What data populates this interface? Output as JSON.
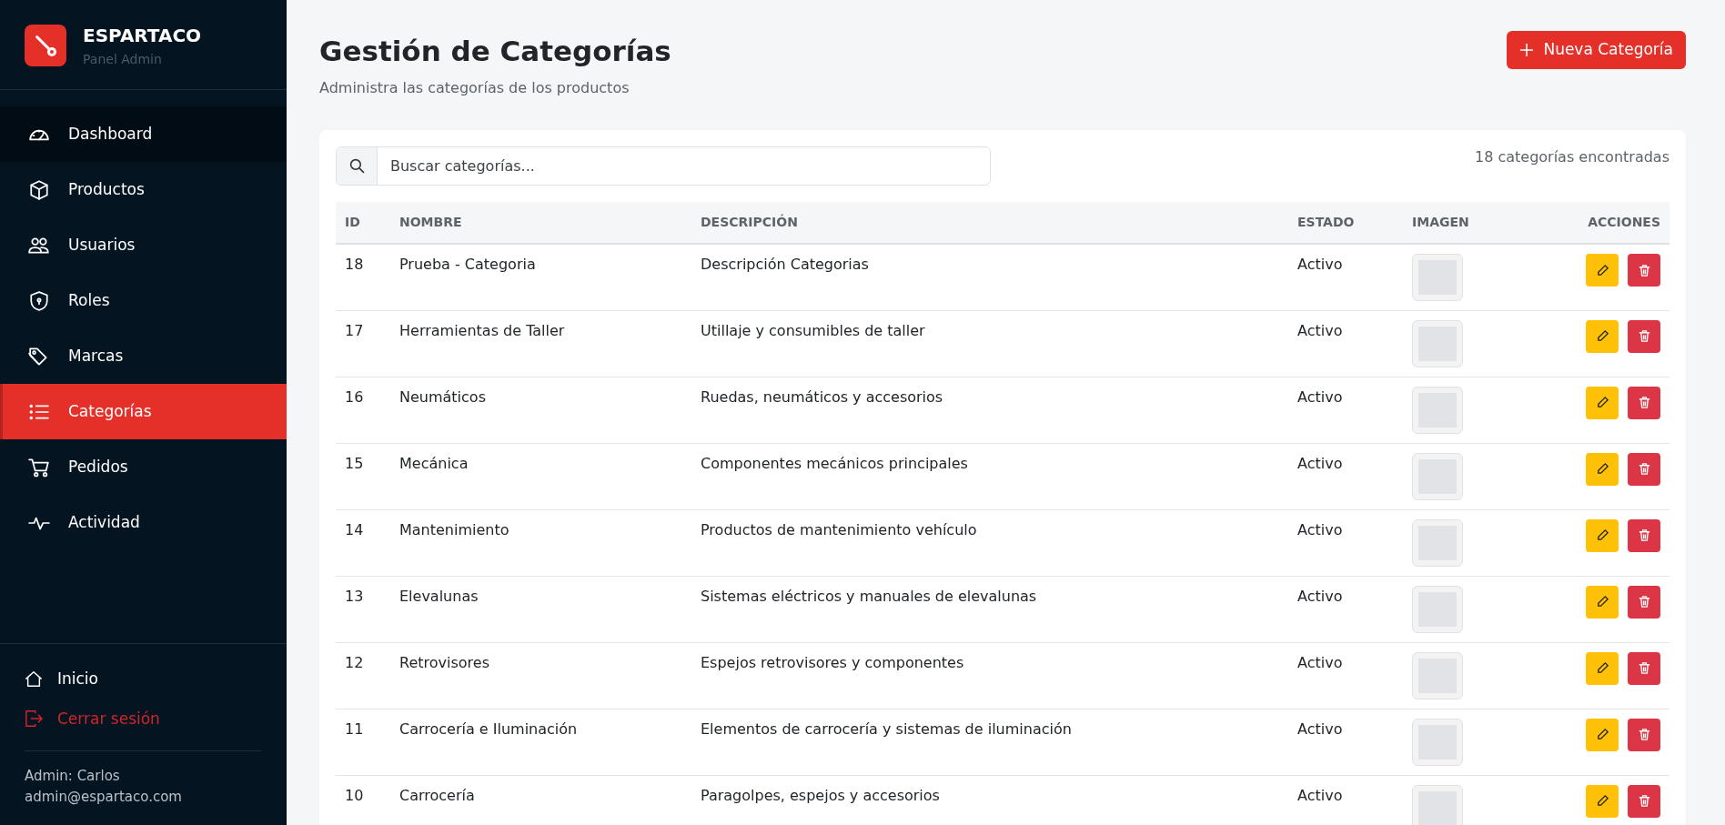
{
  "brand": {
    "title": "ESPARTACO",
    "subtitle": "Panel Admin"
  },
  "nav": [
    {
      "label": "Dashboard",
      "selected": false,
      "highlighted": true
    },
    {
      "label": "Productos",
      "selected": false,
      "highlighted": false
    },
    {
      "label": "Usuarios",
      "selected": false,
      "highlighted": false
    },
    {
      "label": "Roles",
      "selected": false,
      "highlighted": false
    },
    {
      "label": "Marcas",
      "selected": false,
      "highlighted": false
    },
    {
      "label": "Categorías",
      "selected": true,
      "highlighted": false
    },
    {
      "label": "Pedidos",
      "selected": false,
      "highlighted": false
    },
    {
      "label": "Actividad",
      "selected": false,
      "highlighted": false
    }
  ],
  "footer_links": [
    {
      "label": "Inicio",
      "kind": "home"
    },
    {
      "label": "Cerrar sesión",
      "kind": "logout"
    }
  ],
  "user": {
    "name": "Admin: Carlos",
    "email": "admin@espartaco.com"
  },
  "page": {
    "title": "Gestión de Categorías",
    "subtitle": "Administra las categorías de los productos",
    "new_button": "Nueva Categoría"
  },
  "search": {
    "placeholder": "Buscar categorías..."
  },
  "count": "18 categorías encontradas",
  "table": {
    "columns": [
      "ID",
      "NOMBRE",
      "DESCRIPCIÓN",
      "ESTADO",
      "IMAGEN",
      "ACCIONES"
    ],
    "rows": [
      {
        "id": "18",
        "name": "Prueba - Categoria",
        "description": "Descripción Categorias",
        "status": "Activo"
      },
      {
        "id": "17",
        "name": "Herramientas de Taller",
        "description": "Utillaje y consumibles de taller",
        "status": "Activo"
      },
      {
        "id": "16",
        "name": "Neumáticos",
        "description": "Ruedas, neumáticos y accesorios",
        "status": "Activo"
      },
      {
        "id": "15",
        "name": "Mecánica",
        "description": "Componentes mecánicos principales",
        "status": "Activo"
      },
      {
        "id": "14",
        "name": "Mantenimiento",
        "description": "Productos de mantenimiento vehículo",
        "status": "Activo"
      },
      {
        "id": "13",
        "name": "Elevalunas",
        "description": "Sistemas eléctricos y manuales de elevalunas",
        "status": "Activo"
      },
      {
        "id": "12",
        "name": "Retrovisores",
        "description": "Espejos retrovisores y componentes",
        "status": "Activo"
      },
      {
        "id": "11",
        "name": "Carrocería e Iluminación",
        "description": "Elementos de carrocería y sistemas de iluminación",
        "status": "Activo"
      },
      {
        "id": "10",
        "name": "Carrocería",
        "description": "Paragolpes, espejos y accesorios",
        "status": "Activo"
      }
    ]
  }
}
